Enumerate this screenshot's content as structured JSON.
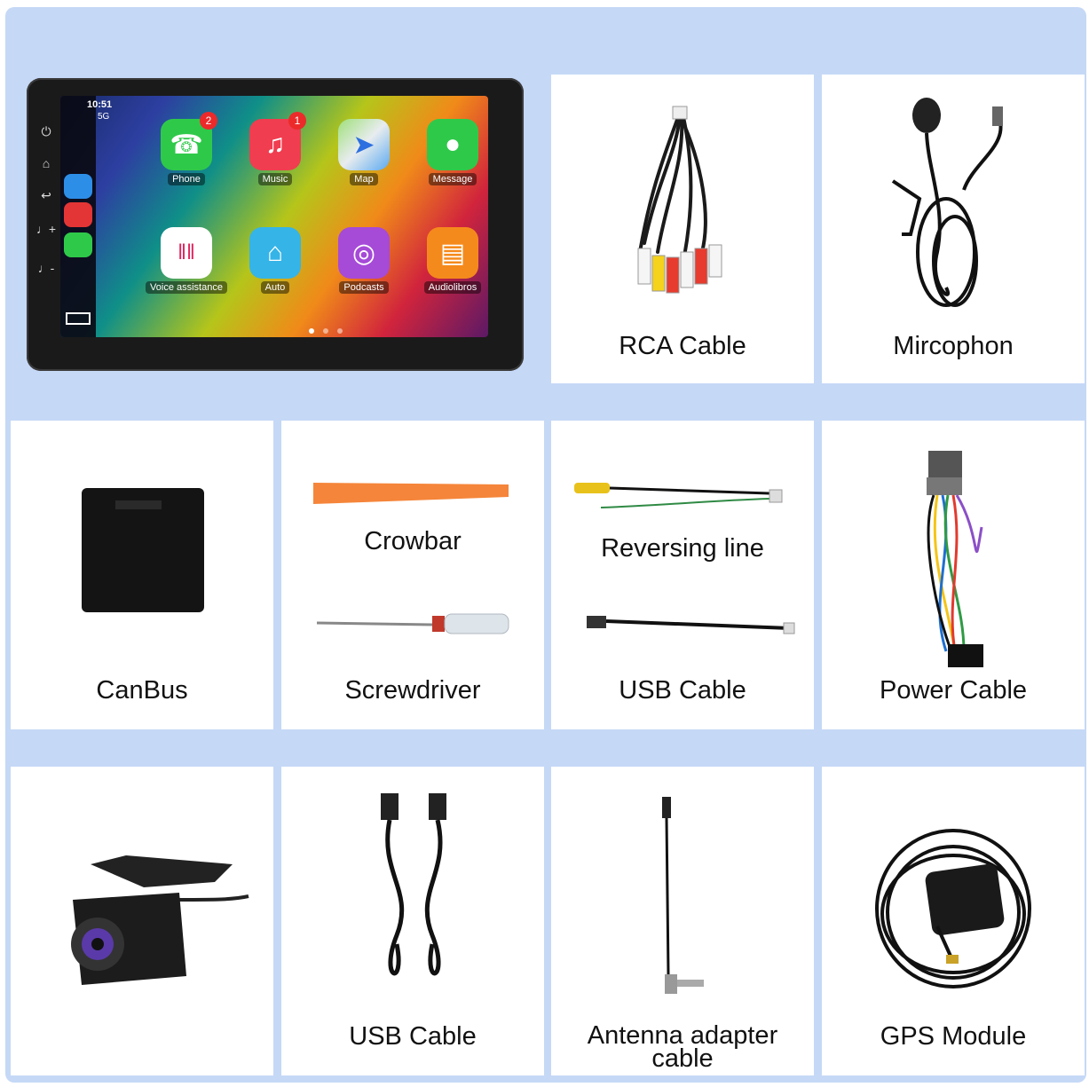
{
  "head_unit": {
    "time": "10:51",
    "signal": "5G",
    "apps": [
      {
        "label": "Phone",
        "icon": "phone-icon",
        "badge": "2",
        "color": "#2fc94a"
      },
      {
        "label": "Music",
        "icon": "music-icon",
        "badge": "1",
        "color": "#f03d4f"
      },
      {
        "label": "Map",
        "icon": "map-icon",
        "badge": "",
        "color": "#e8ecef"
      },
      {
        "label": "Message",
        "icon": "message-icon",
        "badge": "",
        "color": "#2fc94a"
      },
      {
        "label": "Voice assistance",
        "icon": "voice-assistance-icon",
        "badge": "",
        "color": "#ffffff"
      },
      {
        "label": "Auto",
        "icon": "home-icon",
        "badge": "",
        "color": "#35b4e8"
      },
      {
        "label": "Podcasts",
        "icon": "podcasts-icon",
        "badge": "",
        "color": "#a64ad8"
      },
      {
        "label": "Audiolibros",
        "icon": "book-icon",
        "badge": "",
        "color": "#f58a1c"
      }
    ]
  },
  "items": {
    "rca_cable": "RCA Cable",
    "microphone": "Mircophon",
    "canbus": "CanBus",
    "crowbar": "Crowbar",
    "screwdriver": "Screwdriver",
    "reversing_line": "Reversing line",
    "usb_cable_1": "USB Cable",
    "power_cable": "Power Cable",
    "usb_cable_2": "USB Cable",
    "antenna_line1": "Antenna adapter",
    "antenna_line2": "cable",
    "gps_module": "GPS Module"
  },
  "colors": {
    "background": "#c5d8f6",
    "card": "#ffffff"
  }
}
